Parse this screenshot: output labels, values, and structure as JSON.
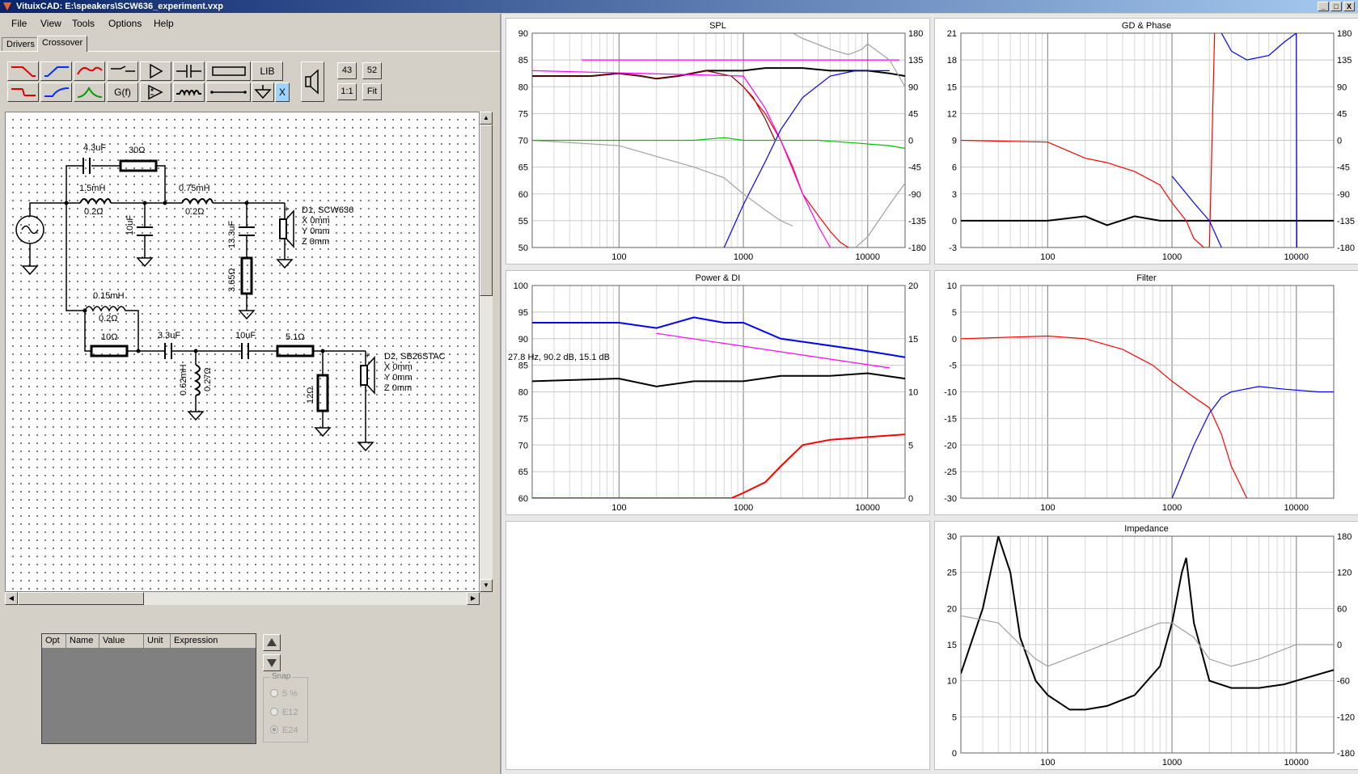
{
  "window": {
    "title": "VituixCAD: E:\\speakers\\SCW636_experiment.vxp",
    "buttons": [
      "_",
      "□",
      "X"
    ]
  },
  "menu": [
    "File",
    "View",
    "Tools",
    "Options",
    "Help"
  ],
  "tabs": [
    {
      "label": "Drivers",
      "active": false
    },
    {
      "label": "Crossover",
      "active": true
    }
  ],
  "toolbar": {
    "row1": [
      "lowpass-red",
      "highpass-blue",
      "bandpass-red",
      "switch",
      "buffer",
      "capacitor",
      "resistor",
      "LIB"
    ],
    "row2": [
      "lowpass-red-2",
      "highpass-blue-2",
      "bandpass-green",
      "G(f)",
      "opamp",
      "inductor",
      "wire",
      "ground",
      "X"
    ],
    "lib_label": "LIB",
    "gf_label": "G(f)",
    "x_label": "X",
    "grid_a": "43",
    "grid_b": "52",
    "zoom_1to1": "1:1",
    "zoom_fit": "Fit"
  },
  "schematic": {
    "c1": "4.3uF",
    "r_30": "30Ω",
    "l1": "1.5mH",
    "l1_r": "0.2Ω",
    "c_10uf": "10uF",
    "l2": "0.75mH",
    "l2_r": "0.2Ω",
    "c_13": "13.3uF",
    "r_365": "3.65Ω",
    "d1_name": "D1, SCW636",
    "d1_x": "X 0mm",
    "d1_y": "Y 0mm",
    "d1_z": "Z 0mm",
    "l3": "0.15mH",
    "l3_r": "0.2Ω",
    "r_10": "10Ω",
    "c_33": "3.3uF",
    "c_10uf_b": "10uF",
    "r_51": "5.1Ω",
    "l4": "0.62mH",
    "l4_r": "0.27Ω",
    "r_12": "12Ω",
    "d2_name": "D2, SB26STAC",
    "d2_x": "X 0mm",
    "d2_y": "Y 0mm",
    "d2_z": "Z 0mm"
  },
  "properties": {
    "columns": [
      "Opt",
      "Name",
      "Value",
      "Unit",
      "Expression"
    ]
  },
  "snap": {
    "legend": "Snap",
    "options": [
      "5 %",
      "E12",
      "E24"
    ],
    "selected": "E24"
  },
  "colors": {
    "red": "#ff0000",
    "blue": "#0000ff",
    "green": "#00c000",
    "magenta": "#ff00ff",
    "darkred": "#800000",
    "gray": "#a0a0a0"
  },
  "chart_data": [
    {
      "type": "line",
      "title": "SPL",
      "x_scale": "log",
      "xlim": [
        20,
        20000
      ],
      "x_ticks": [
        "100",
        "1000",
        "10000"
      ],
      "ylim": [
        50,
        90
      ],
      "y_ticks": [
        "90",
        "85",
        "80",
        "75",
        "70",
        "65",
        "60",
        "55",
        "50"
      ],
      "y2lim": [
        -180,
        180
      ],
      "y2_ticks": [
        "180",
        "135",
        "90",
        "45",
        "0",
        "-45",
        "-90",
        "-135",
        "-180"
      ],
      "series": [
        {
          "color": "black",
          "x": [
            20,
            60,
            100,
            150,
            200,
            300,
            500,
            800,
            1000,
            1500,
            2000,
            3000,
            5000,
            8000,
            10000,
            15000,
            20000
          ],
          "y": [
            82,
            82,
            82.5,
            82,
            81.5,
            82,
            83,
            83,
            83,
            83.5,
            83.5,
            83.5,
            83,
            83,
            83,
            82.5,
            82
          ]
        },
        {
          "color": "darkred",
          "x": [
            20,
            60,
            100,
            150,
            200,
            300,
            500,
            800,
            1000,
            1200,
            1500,
            1800
          ],
          "y": [
            82,
            82,
            82.5,
            82,
            81.5,
            82,
            83,
            82,
            80,
            78,
            74,
            70
          ]
        },
        {
          "color": "red",
          "x": [
            1000,
            1500,
            2000,
            2500,
            3000,
            4000,
            5000,
            6000,
            7000
          ],
          "y": [
            80,
            75,
            70,
            65,
            60,
            56,
            53,
            51,
            50
          ]
        },
        {
          "color": "magenta",
          "x": [
            20,
            1000,
            1500,
            2000,
            3000,
            4000,
            5000
          ],
          "y": [
            83,
            82,
            76,
            70,
            60,
            54,
            50
          ]
        },
        {
          "color": "magenta",
          "x": [
            50,
            18000
          ],
          "y": [
            85,
            85
          ]
        },
        {
          "color": "blue",
          "x": [
            700,
            1000,
            1500,
            2000,
            3000,
            5000,
            8000,
            10000,
            15000
          ],
          "y": [
            50,
            58,
            66,
            72,
            78,
            82,
            83,
            83,
            83
          ]
        },
        {
          "color": "gray",
          "x": [
            20,
            100,
            200,
            400,
            700,
            1000,
            1500,
            2000,
            2500
          ],
          "y": [
            70,
            69,
            67,
            65,
            63,
            60,
            57,
            55,
            54
          ]
        },
        {
          "color": "gray",
          "x": [
            2500,
            3000,
            5000,
            7000,
            9000,
            10000,
            15000,
            20000
          ],
          "y": [
            90,
            89,
            87,
            86,
            87,
            88,
            85,
            80
          ]
        },
        {
          "color": "gray",
          "x": [
            8000,
            10000,
            15000,
            20000
          ],
          "y": [
            50,
            52,
            58,
            62
          ]
        },
        {
          "color": "green",
          "x": [
            20,
            100,
            200,
            400,
            700,
            1000,
            2000,
            4000,
            8000,
            15000,
            20000
          ],
          "y": [
            70,
            70,
            70,
            70,
            70.5,
            70,
            70,
            70,
            69.5,
            69,
            68.5
          ]
        }
      ]
    },
    {
      "type": "line",
      "title": "GD & Phase",
      "x_scale": "log",
      "xlim": [
        20,
        20000
      ],
      "x_ticks": [
        "100",
        "1000",
        "10000"
      ],
      "ylim": [
        -3,
        21
      ],
      "y_ticks": [
        "21",
        "18",
        "15",
        "12",
        "9",
        "6",
        "3",
        "0",
        "-3"
      ],
      "y2lim": [
        -180,
        180
      ],
      "y2_ticks": [
        "180",
        "135",
        "90",
        "45",
        "0",
        "-45",
        "-90",
        "-135",
        "-180"
      ],
      "series": [
        {
          "color": "black",
          "x": [
            20,
            100,
            200,
            300,
            500,
            800,
            1000,
            2000,
            5000,
            10000,
            20000
          ],
          "y": [
            0,
            0,
            0.5,
            -0.5,
            0.5,
            0,
            0,
            0,
            0,
            0,
            0
          ]
        },
        {
          "color": "red",
          "x": [
            20,
            100,
            200,
            300,
            500,
            800,
            1000,
            1300,
            1500,
            1800,
            2000,
            2200
          ],
          "y": [
            9,
            8.8,
            7,
            6.5,
            5.5,
            4,
            2,
            0,
            -2,
            -3,
            -3,
            21
          ]
        },
        {
          "color": "blue",
          "x": [
            1000,
            1500,
            2000,
            2500
          ],
          "y": [
            5,
            2,
            0,
            -3
          ]
        },
        {
          "color": "blue",
          "x": [
            2500,
            3000,
            4000,
            6000,
            8000,
            10000,
            10100
          ],
          "y": [
            21,
            19,
            18,
            18.5,
            20,
            21,
            -3
          ]
        }
      ]
    },
    {
      "type": "line",
      "title": "Power & DI",
      "x_scale": "log",
      "xlim": [
        20,
        20000
      ],
      "x_ticks": [
        "100",
        "1000",
        "10000"
      ],
      "ylim": [
        60,
        100
      ],
      "y_ticks": [
        "100",
        "95",
        "90",
        "85",
        "80",
        "75",
        "70",
        "65",
        "60"
      ],
      "y2lim": [
        0,
        20
      ],
      "y2_ticks": [
        "20",
        "15",
        "10",
        "5",
        "0"
      ],
      "annotation": "27.8 Hz, 90.2 dB, 15.1 dB",
      "series": [
        {
          "color": "blue",
          "x": [
            20,
            100,
            200,
            400,
            700,
            1000,
            2000,
            4000,
            8000,
            15000,
            20000
          ],
          "y": [
            93,
            93,
            92,
            94,
            93,
            93,
            90,
            89,
            88,
            87,
            86.5
          ]
        },
        {
          "color": "black",
          "x": [
            20,
            100,
            200,
            400,
            700,
            1000,
            2000,
            5000,
            10000,
            20000
          ],
          "y": [
            82,
            82.5,
            81,
            82,
            82,
            82,
            83,
            83,
            83.5,
            82.5
          ]
        },
        {
          "color": "red",
          "x": [
            20,
            500,
            800,
            1000,
            1500,
            2000,
            3000,
            5000,
            10000,
            20000
          ],
          "y": [
            60,
            60,
            60,
            61,
            63,
            66,
            70,
            71,
            71.5,
            72
          ]
        },
        {
          "color": "magenta",
          "x": [
            200,
            15000
          ],
          "y": [
            91,
            84.5
          ]
        }
      ]
    },
    {
      "type": "line",
      "title": "Filter",
      "x_scale": "log",
      "xlim": [
        20,
        20000
      ],
      "x_ticks": [
        "100",
        "1000",
        "10000"
      ],
      "ylim": [
        -30,
        10
      ],
      "y_ticks": [
        "10",
        "5",
        "0",
        "-5",
        "-10",
        "-15",
        "-20",
        "-25",
        "-30"
      ],
      "series": [
        {
          "color": "red",
          "x": [
            20,
            100,
            200,
            400,
            700,
            1000,
            1500,
            2000,
            2500,
            3000,
            4000
          ],
          "y": [
            0,
            0.5,
            0,
            -2,
            -5,
            -8,
            -11,
            -13,
            -18,
            -24,
            -30
          ]
        },
        {
          "color": "blue",
          "x": [
            1000,
            1500,
            2000,
            2500,
            3000,
            5000,
            8000,
            15000,
            20000
          ],
          "y": [
            -30,
            -20,
            -14,
            -11,
            -10,
            -9,
            -9.5,
            -10,
            -10
          ]
        }
      ]
    },
    {
      "type": "line",
      "title": "Impedance",
      "x_scale": "log",
      "xlim": [
        20,
        20000
      ],
      "x_ticks": [
        "100",
        "1000",
        "10000"
      ],
      "ylim": [
        0,
        30
      ],
      "y_ticks": [
        "30",
        "25",
        "20",
        "15",
        "10",
        "5",
        "0"
      ],
      "y2lim": [
        -180,
        180
      ],
      "y2_ticks": [
        "180",
        "120",
        "60",
        "0",
        "-60",
        "-120",
        "-180"
      ],
      "series": [
        {
          "color": "black",
          "x": [
            20,
            30,
            40,
            50,
            60,
            80,
            100,
            150,
            200,
            300,
            500,
            800,
            1000,
            1200,
            1300,
            1500,
            2000,
            3000,
            5000,
            8000,
            10000,
            20000
          ],
          "y": [
            11,
            20,
            30,
            25,
            16,
            10,
            8,
            6,
            6,
            6.5,
            8,
            12,
            18,
            25,
            27,
            18,
            10,
            9,
            9,
            9.5,
            10,
            11.5
          ]
        },
        {
          "color": "gray",
          "x": [
            20,
            40,
            60,
            80,
            100,
            200,
            400,
            800,
            1000,
            1500,
            2000,
            3000,
            5000,
            10000,
            20000
          ],
          "y": [
            19,
            18,
            15,
            13,
            12,
            14,
            16,
            18,
            18,
            16,
            13,
            12,
            13,
            15,
            15
          ]
        }
      ]
    }
  ]
}
